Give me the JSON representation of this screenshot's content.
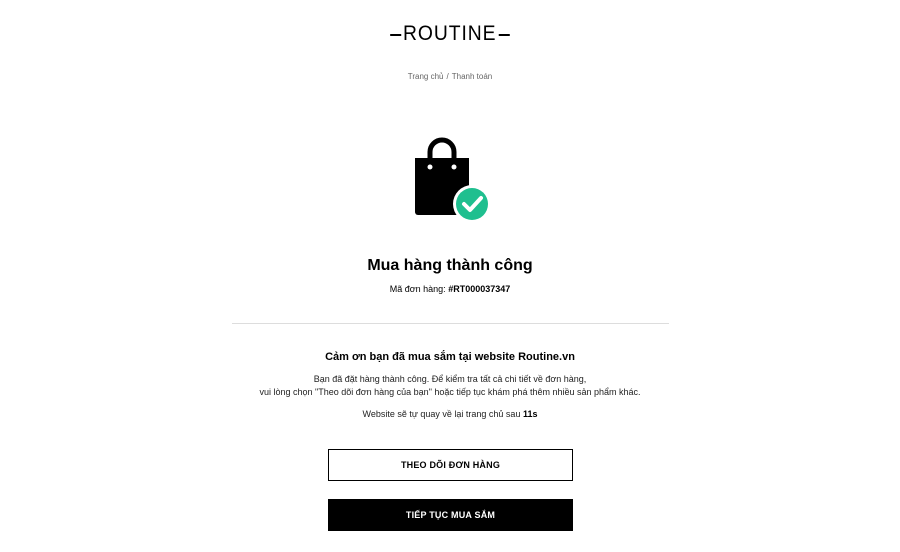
{
  "header": {
    "logo_text": "ROUTINE"
  },
  "breadcrumb": {
    "home": "Trang chủ",
    "separator": "/",
    "current": "Thanh toán"
  },
  "icons": {
    "bag": "shopping-bag-icon",
    "check": "check-circle-icon"
  },
  "colors": {
    "accent": "#1fbf8f",
    "primary": "#000000"
  },
  "success": {
    "title": "Mua hàng thành công",
    "order_label": "Mã đơn hàng:",
    "order_code": "#RT000037347"
  },
  "message": {
    "thanks_title": "Cảm ơn bạn đã mua sắm tại website Routine.vn",
    "line1": "Bạn đã đặt hàng thành công. Để kiểm tra tất cả chi tiết về đơn hàng,",
    "line2": "vui lòng chọn \"Theo dõi đơn hàng của bạn\" hoặc tiếp tục khám phá thêm nhiều sản phẩm khác.",
    "redirect_text": "Website sẽ tự quay về lại trang chủ sau",
    "redirect_count": "11s"
  },
  "buttons": {
    "track_order": "THEO DÕI ĐƠN HÀNG",
    "continue_shopping": "TIẾP TỤC MUA SẮM"
  }
}
